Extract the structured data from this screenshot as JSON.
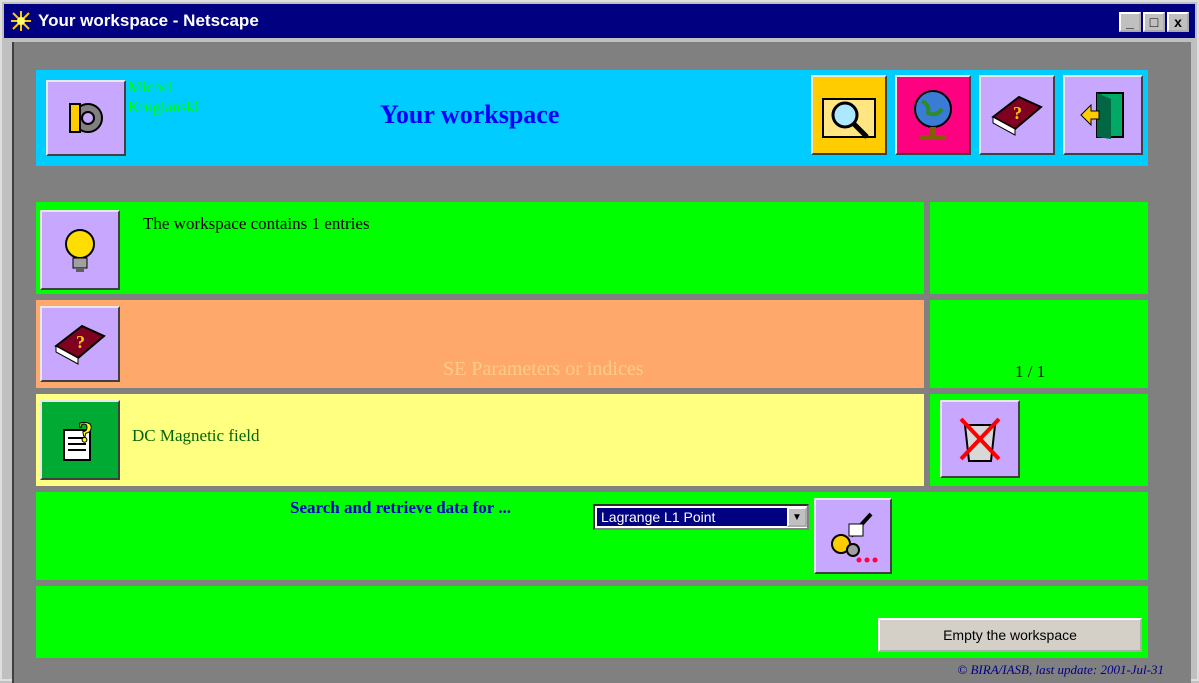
{
  "window": {
    "title": "Your workspace - Netscape",
    "controls": {
      "minimize": "_",
      "maximize": "□",
      "close": "x"
    }
  },
  "header": {
    "user_name": "Michel Kruglanski",
    "title": "Your workspace",
    "toolbar_icons": [
      "search-icon",
      "globe-icon",
      "help-book-icon",
      "exit-door-icon"
    ]
  },
  "info": {
    "entries_text": "The workspace contains 1 entries"
  },
  "category": {
    "label": "SE Parameters or indices",
    "page_indicator": "1 / 1"
  },
  "entry": {
    "label": "DC Magnetic field"
  },
  "search": {
    "label": "Search and retrieve data for ...",
    "selected_option": "Lagrange L1 Point"
  },
  "actions": {
    "empty_label": "Empty the workspace"
  },
  "footer": {
    "text": "© BIRA/IASB, last update: 2001-Jul-31"
  },
  "colors": {
    "header_bg": "#00ccff",
    "panel_green": "#00ff00",
    "category_orange": "#ffa86b",
    "entry_yellow": "#ffff80",
    "title_blue": "#0000ff"
  }
}
